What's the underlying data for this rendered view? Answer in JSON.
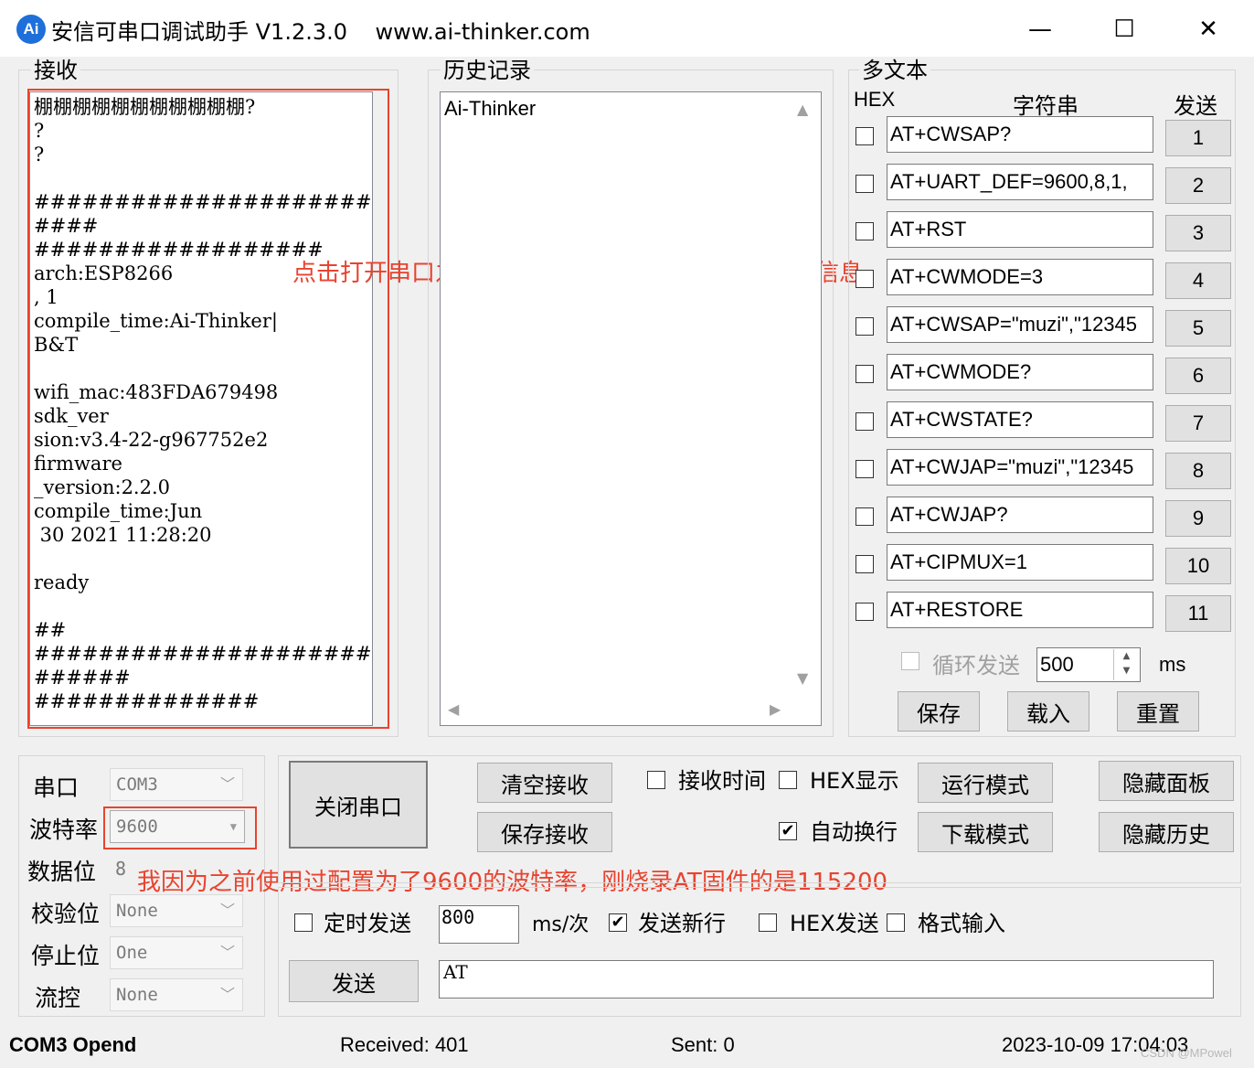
{
  "window": {
    "title": "安信可串口调试助手 V1.2.3.0    www.ai-thinker.com",
    "logo_text": "Ai",
    "minimize": "—",
    "maximize": "☐",
    "close": "✕"
  },
  "receive": {
    "label": "接收",
    "content": "棚棚棚棚棚棚棚棚棚棚棚?\n?\n?\n\n##########################\n####\n##################\narch:ESP8266\n, 1\ncompile_time:Ai-Thinker|\nB&T\n\nwifi_mac:483FDA679498\nsdk_ver\nsion:v3.4-22-g967752e2\nfirmware\n_version:2.2.0\ncompile_time:Jun\n 30 2021 11:28:20\n\nready\n\n##\n##########################\n######\n##############"
  },
  "annotations": {
    "note1": "点击打开串口之后会出现一堆乱码还有设备的一些信息",
    "note2": "我因为之前使用过配置为了9600的波特率，刚烧录AT固件的是115200"
  },
  "history": {
    "label": "历史记录",
    "items": [
      "Ai-Thinker"
    ]
  },
  "multi": {
    "label": "多文本",
    "col_hex": "HEX",
    "col_string": "字符串",
    "col_send": "发送",
    "rows": [
      {
        "text": "AT+CWSAP?",
        "num": "1"
      },
      {
        "text": "AT+UART_DEF=9600,8,1,",
        "num": "2"
      },
      {
        "text": "AT+RST",
        "num": "3"
      },
      {
        "text": "AT+CWMODE=3",
        "num": "4"
      },
      {
        "text": "AT+CWSAP=\"muzi\",\"12345",
        "num": "5"
      },
      {
        "text": "AT+CWMODE?",
        "num": "6"
      },
      {
        "text": "AT+CWSTATE?",
        "num": "7"
      },
      {
        "text": "AT+CWJAP=\"muzi\",\"12345",
        "num": "8"
      },
      {
        "text": "AT+CWJAP?",
        "num": "9"
      },
      {
        "text": "AT+CIPMUX=1",
        "num": "10"
      },
      {
        "text": "AT+RESTORE",
        "num": "11"
      }
    ],
    "loop_send": "循环发送",
    "interval": "500",
    "unit": "ms",
    "save": "保存",
    "load": "载入",
    "reset": "重置"
  },
  "serial": {
    "port_label": "串口",
    "port_value": "COM3",
    "baud_label": "波特率",
    "baud_value": "9600",
    "data_label": "数据位",
    "data_value": "8",
    "parity_label": "校验位",
    "parity_value": "None",
    "stop_label": "停止位",
    "stop_value": "One",
    "flow_label": "流控",
    "flow_value": "None"
  },
  "controls": {
    "close_port": "关闭串口",
    "clear_recv": "清空接收",
    "save_recv": "保存接收",
    "recv_time": "接收时间",
    "hex_display": "HEX显示",
    "auto_wrap": "自动换行",
    "run_mode": "运行模式",
    "download_mode": "下载模式",
    "hide_panel": "隐藏面板",
    "hide_history": "隐藏历史",
    "timed_send": "定时发送",
    "timed_value": "800",
    "timed_unit": "ms/次",
    "send_newline": "发送新行",
    "hex_send": "HEX发送",
    "format_input": "格式输入",
    "send": "发送",
    "send_text": "AT",
    "check": "✔"
  },
  "status": {
    "port": "COM3 Opend",
    "received": "Received: 401",
    "sent": "Sent: 0",
    "datetime": "2023-10-09 17:04:03",
    "watermark": "CSDN @MPowel"
  }
}
